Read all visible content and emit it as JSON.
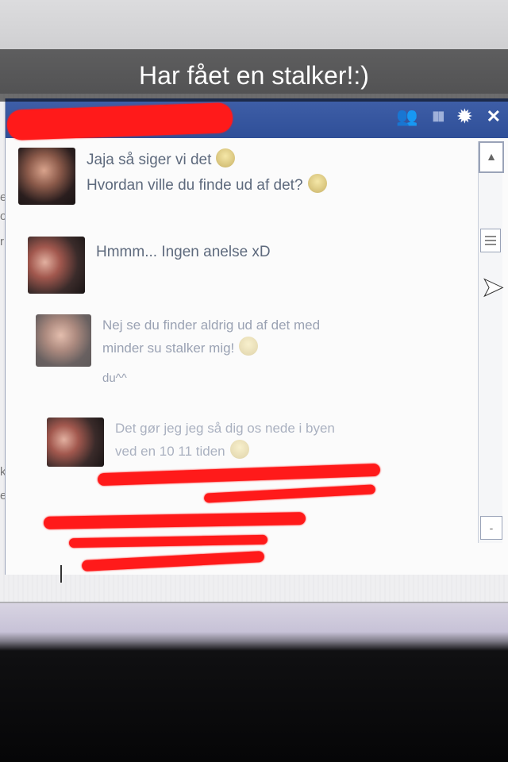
{
  "snap_caption": "Har fået en stalker!:)",
  "left_panel": {
    "fragments": [
      "er",
      "ol",
      "r d",
      "klar",
      "en -."
    ]
  },
  "chat": {
    "header_icons": [
      "add-friend-icon",
      "video-icon",
      "gear-icon",
      "close-icon"
    ],
    "messages": [
      {
        "lines": [
          "Jaja så siger vi det",
          "Hvordan ville du finde ud af det?"
        ],
        "emoji": [
          "smiley-icon",
          "smiley-icon"
        ]
      },
      {
        "lines": [
          "Hmmm... Ingen anelse xD"
        ]
      },
      {
        "lines": [
          "Nej se du finder aldrig ud af det med",
          "minder su stalker mig!",
          "du^^"
        ],
        "emoji": [
          "smiley-icon"
        ]
      },
      {
        "lines": [
          "Det gør jeg jeg så dig os nede i byen",
          "ved en 10 11 tiden"
        ],
        "emoji": [
          "smiley-icon"
        ]
      }
    ],
    "glyphs": {
      "scroll_up": "▲",
      "scroll_down": "-",
      "add_friend": "👥",
      "video": "▮▮",
      "gear": "✹",
      "close": "✕",
      "cursor": "➤"
    }
  }
}
